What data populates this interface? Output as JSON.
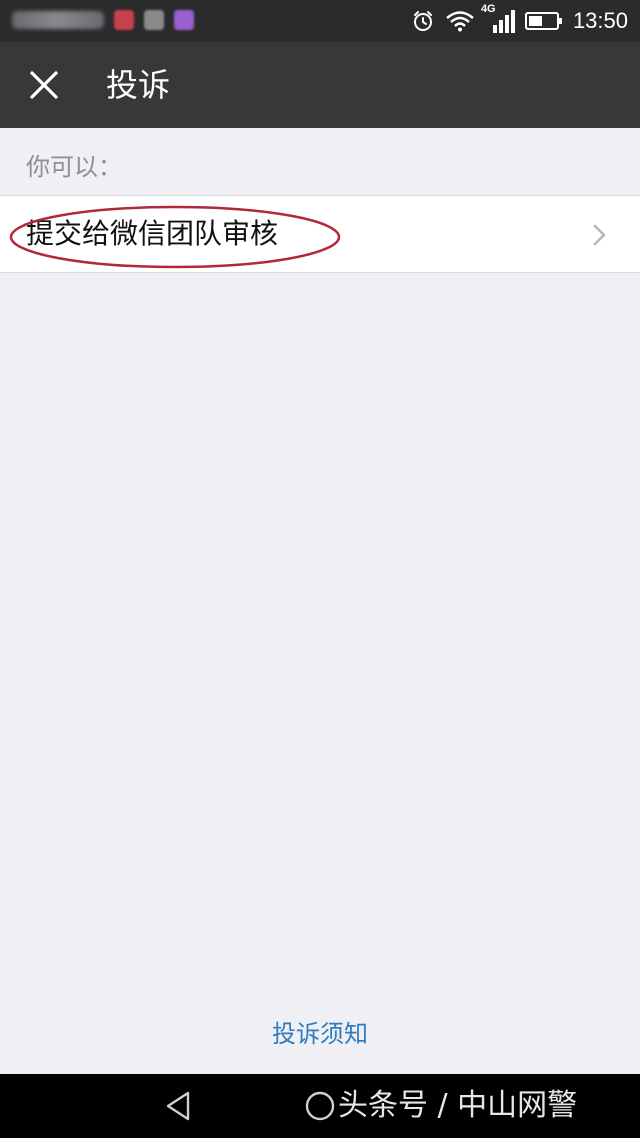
{
  "status_bar": {
    "time": "13:50",
    "network": "4G",
    "icons": [
      "alarm-icon",
      "wifi-icon",
      "signal-icon",
      "battery-icon"
    ],
    "notification_icon_colors": [
      "#c8404a",
      "#8a8a8a",
      "#9a5fd0"
    ]
  },
  "nav": {
    "title": "投诉",
    "close_icon": "close-icon"
  },
  "section": {
    "label": "你可以："
  },
  "options": [
    {
      "label": "提交给微信团队审核",
      "icon": "chevron-right-icon"
    }
  ],
  "footer": {
    "link": "投诉须知"
  },
  "watermark": {
    "text": "头条号 / 中山网警"
  },
  "colors": {
    "nav_bg": "#38383b",
    "status_bg": "#2b2b2d",
    "page_bg": "#efeff4",
    "link": "#2f7dc0",
    "annotation": "#b0283a"
  }
}
